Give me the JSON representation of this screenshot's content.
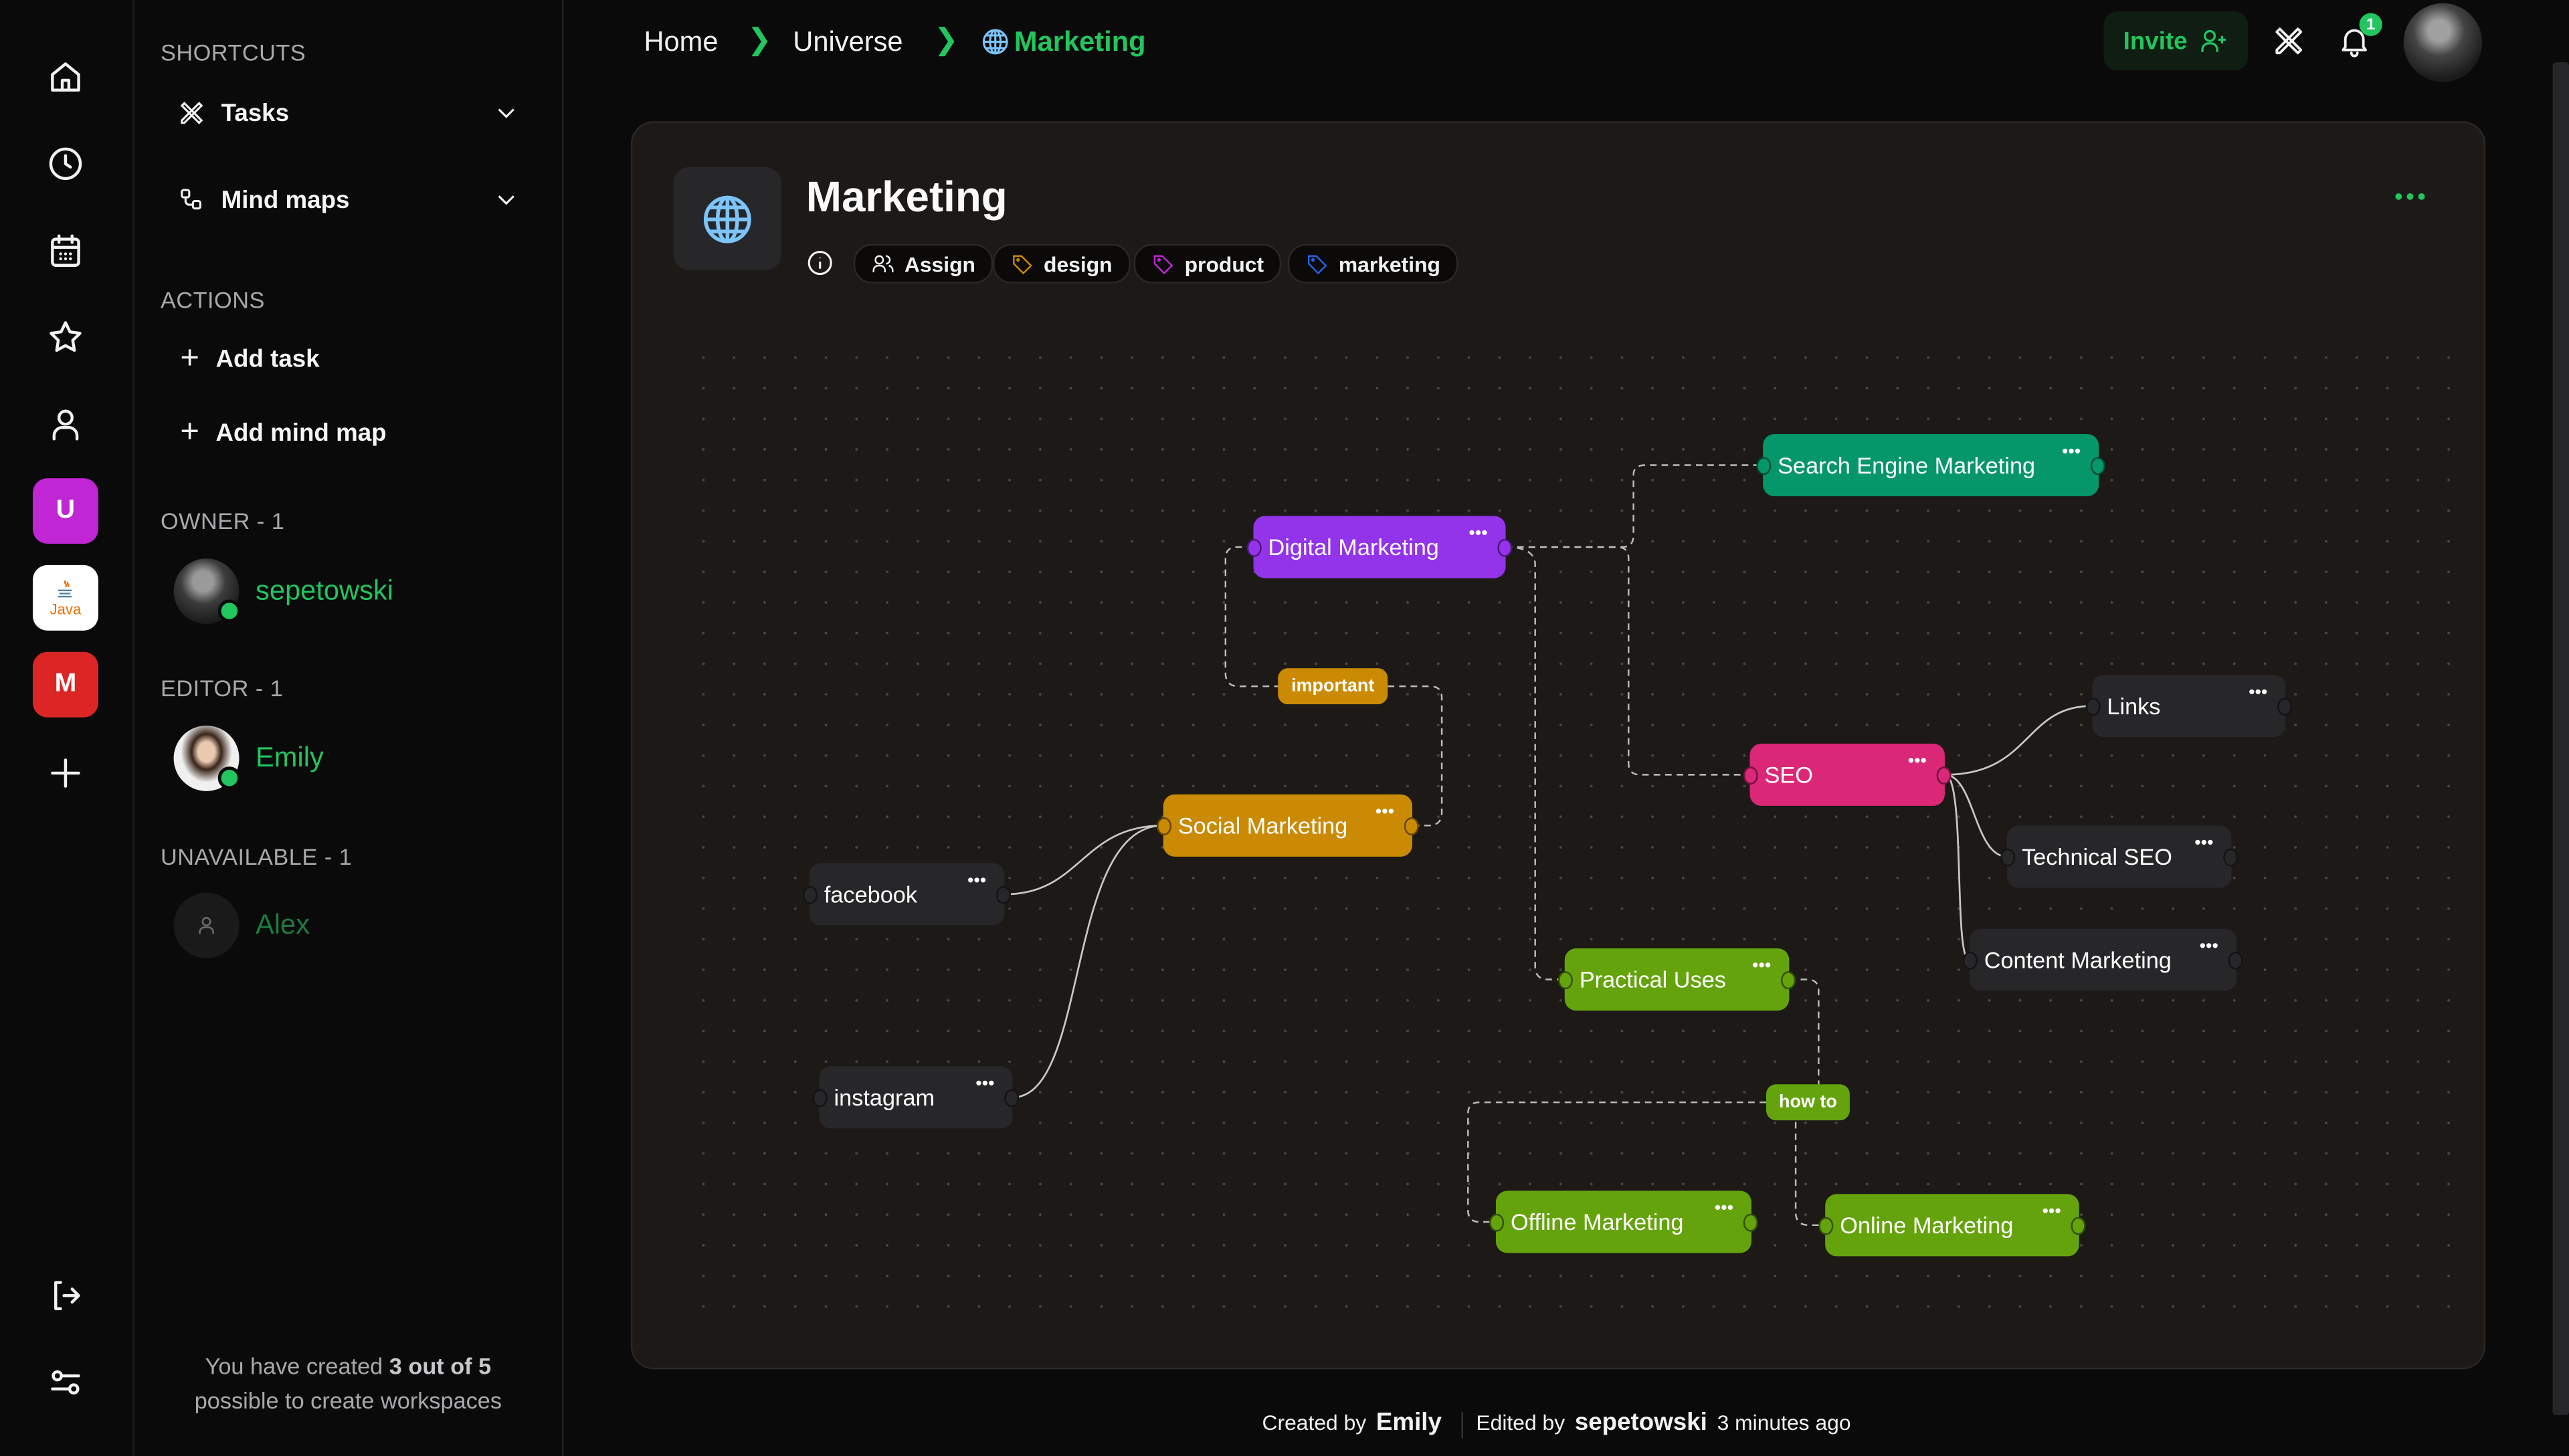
{
  "rail": {
    "icons": [
      "home-icon",
      "clock-icon",
      "calendar-icon",
      "star-icon",
      "user-icon"
    ],
    "workspaces": [
      {
        "label": "U",
        "color": "#c026d3"
      },
      {
        "label": "Java",
        "color": "#ffffff"
      },
      {
        "label": "M",
        "color": "#dc2626"
      }
    ],
    "add_label": "+"
  },
  "sidebar": {
    "shortcuts_title": "SHORTCUTS",
    "shortcuts": [
      {
        "label": "Tasks",
        "icon": "tasks-icon"
      },
      {
        "label": "Mind maps",
        "icon": "mindmap-icon"
      }
    ],
    "actions_title": "ACTIONS",
    "actions": [
      {
        "label": "Add task"
      },
      {
        "label": "Add mind map"
      }
    ],
    "owner_title": "OWNER - 1",
    "owner": {
      "name": "sepetowski",
      "online": true
    },
    "editor_title": "EDITOR - 1",
    "editor": {
      "name": "Emily",
      "online": true
    },
    "unavailable_title": "UNAVAILABLE - 1",
    "unavailable": {
      "name": "Alex"
    },
    "quota_prefix": "You have created ",
    "quota_bold": "3 out of 5",
    "quota_suffix": "possible to create workspaces"
  },
  "header": {
    "breadcrumb": [
      "Home",
      "Universe",
      "Marketing"
    ],
    "invite_label": "Invite",
    "notification_count": "1"
  },
  "card": {
    "title": "Marketing",
    "assign_label": "Assign",
    "tags": [
      {
        "label": "design",
        "color": "#ca8a04"
      },
      {
        "label": "product",
        "color": "#c026d3"
      },
      {
        "label": "marketing",
        "color": "#2563eb"
      }
    ]
  },
  "mindmap": {
    "nodes": [
      {
        "id": "sem",
        "label": "Search Engine Marketing",
        "color": "#059669"
      },
      {
        "id": "dm",
        "label": "Digital Marketing",
        "color": "#9333ea"
      },
      {
        "id": "seo",
        "label": "SEO",
        "color": "#db2777"
      },
      {
        "id": "links",
        "label": "Links",
        "color": "#27272a"
      },
      {
        "id": "tseo",
        "label": "Technical SEO",
        "color": "#27272a"
      },
      {
        "id": "cm",
        "label": "Content Marketing",
        "color": "#27272a"
      },
      {
        "id": "sm",
        "label": "Social Marketing",
        "color": "#ca8a04"
      },
      {
        "id": "fb",
        "label": "facebook",
        "color": "#27272a"
      },
      {
        "id": "ig",
        "label": "instagram",
        "color": "#27272a"
      },
      {
        "id": "pu",
        "label": "Practical Uses",
        "color": "#65a30d"
      },
      {
        "id": "off",
        "label": "Offline Marketing",
        "color": "#65a30d"
      },
      {
        "id": "on",
        "label": "Online Marketing",
        "color": "#65a30d"
      }
    ],
    "edge_labels": [
      {
        "label": "important",
        "color": "#ca8a04"
      },
      {
        "label": "how to",
        "color": "#65a30d"
      }
    ]
  },
  "footer": {
    "created_prefix": "Created by",
    "created_by": "Emily",
    "edited_prefix": "Edited by",
    "edited_by": "sepetowski",
    "edited_when": "3 minutes ago"
  }
}
